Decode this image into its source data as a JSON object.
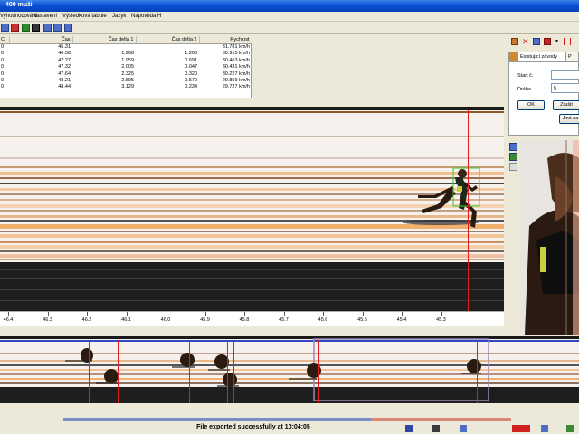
{
  "window": {
    "title": "400 muži"
  },
  "menu": [
    "Vyhodnocování",
    "Nastavení",
    "Výsledková tabule",
    "Jazyk",
    "Nápověda H"
  ],
  "results": {
    "columns": [
      "C",
      "Čas",
      "Čas delta 1",
      "Čas delta 2",
      "Rychlost"
    ],
    "rows": [
      [
        "0",
        "45.31",
        "",
        "",
        "31.781 km/h"
      ],
      [
        "0",
        "46.58",
        "1.268",
        "1.268",
        "30.915 km/h"
      ],
      [
        "0",
        "47.27",
        "1.959",
        "0.691",
        "30.463 km/h"
      ],
      [
        "0",
        "47.32",
        "2.005",
        "0.047",
        "30.431 km/h"
      ],
      [
        "0",
        "47.64",
        "2.325",
        "0.320",
        "30.227 km/h"
      ],
      [
        "0",
        "48.21",
        "2.895",
        "0.570",
        "29.869 km/h"
      ],
      [
        "0",
        "48.44",
        "3.129",
        "0.234",
        "29.727 km/h"
      ]
    ]
  },
  "panel": {
    "tab_active": "Existující závody",
    "tab_other": "P",
    "start_label": "Start č.",
    "start_value": "",
    "lane_label": "Dráha",
    "lane_value": "5",
    "ok_label": "OK",
    "cancel_label": "Zrušit",
    "other_label": "Jiná na"
  },
  "timeline": {
    "labels": [
      "46.4",
      "46.3",
      "46.2",
      "46.1",
      "46.0",
      "45.9",
      "45.8",
      "45.7",
      "45.6",
      "45.5",
      "45.4",
      "45.3"
    ]
  },
  "status": {
    "message": "File exported successfully at 10:04:05"
  },
  "colors": {
    "titlebar": "#0a4fd6",
    "finish_line": "#e02020",
    "highlight_box": "#33cc33"
  }
}
